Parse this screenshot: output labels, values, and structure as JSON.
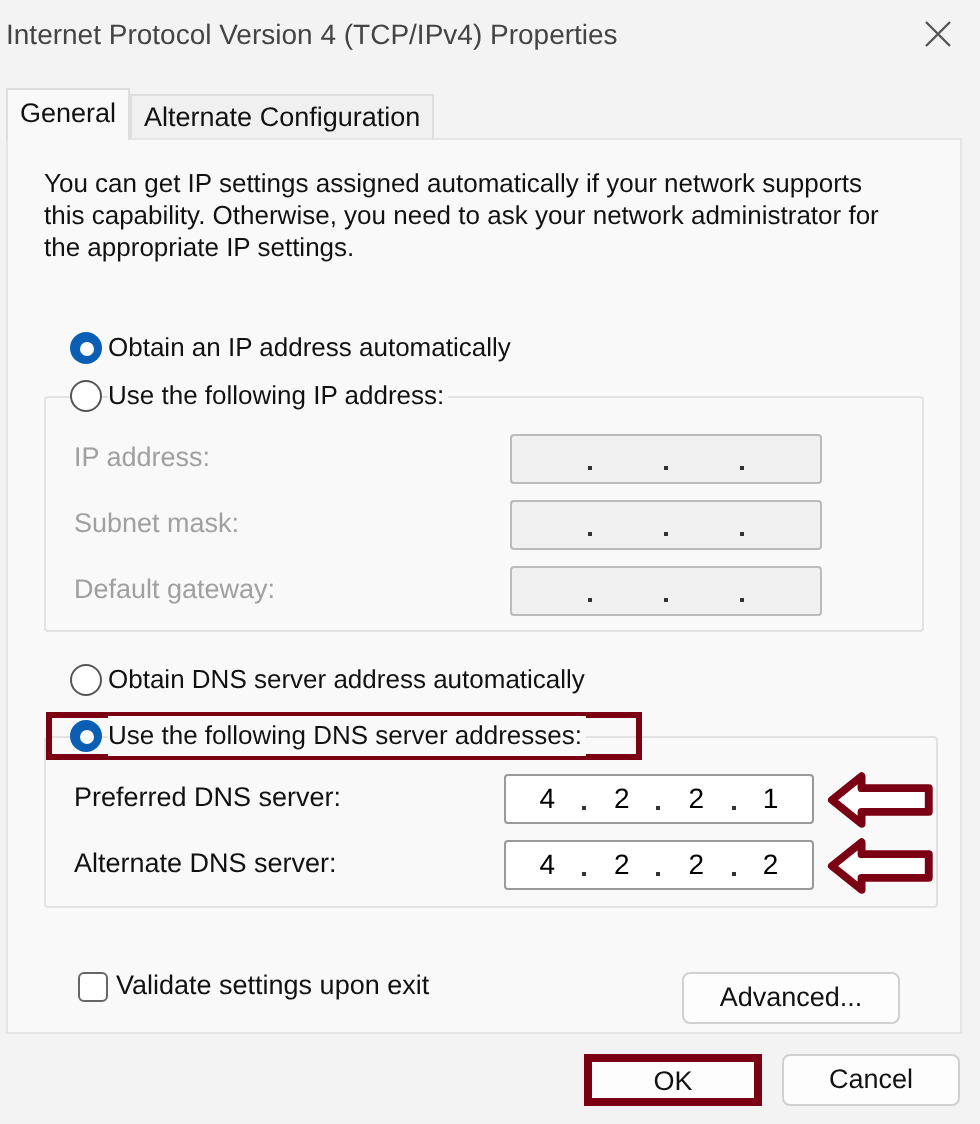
{
  "window": {
    "title": "Internet Protocol Version 4 (TCP/IPv4) Properties"
  },
  "tabs": [
    {
      "label": "General",
      "selected": true
    },
    {
      "label": "Alternate Configuration",
      "selected": false
    }
  ],
  "description": "You can get IP settings assigned automatically if your network supports this capability. Otherwise, you need to ask your network administrator for the appropriate IP settings.",
  "ip_options": [
    {
      "label": "Obtain an IP address automatically",
      "selected": true
    },
    {
      "label": "Use the following IP address:",
      "selected": false
    }
  ],
  "ip_fields": [
    {
      "label": "IP address:",
      "disabled": true
    },
    {
      "label": "Subnet mask:",
      "disabled": true
    },
    {
      "label": "Default gateway:",
      "disabled": true
    }
  ],
  "dns_options": [
    {
      "label": "Obtain DNS server address automatically",
      "selected": false,
      "highlighted": false
    },
    {
      "label": "Use the following DNS server addresses:",
      "selected": true,
      "highlighted": true
    }
  ],
  "dns_fields": [
    {
      "label": "Preferred DNS server:",
      "disabled": false,
      "octets": [
        "4",
        "2",
        "2",
        "1"
      ],
      "arrow": true
    },
    {
      "label": "Alternate DNS server:",
      "disabled": false,
      "octets": [
        "4",
        "2",
        "2",
        "2"
      ],
      "arrow": true
    }
  ],
  "validate": {
    "label": "Validate settings upon exit",
    "checked": false
  },
  "advanced_button": "Advanced...",
  "buttons": [
    {
      "label": "OK",
      "highlighted": true
    },
    {
      "label": "Cancel",
      "highlighted": false
    }
  ]
}
